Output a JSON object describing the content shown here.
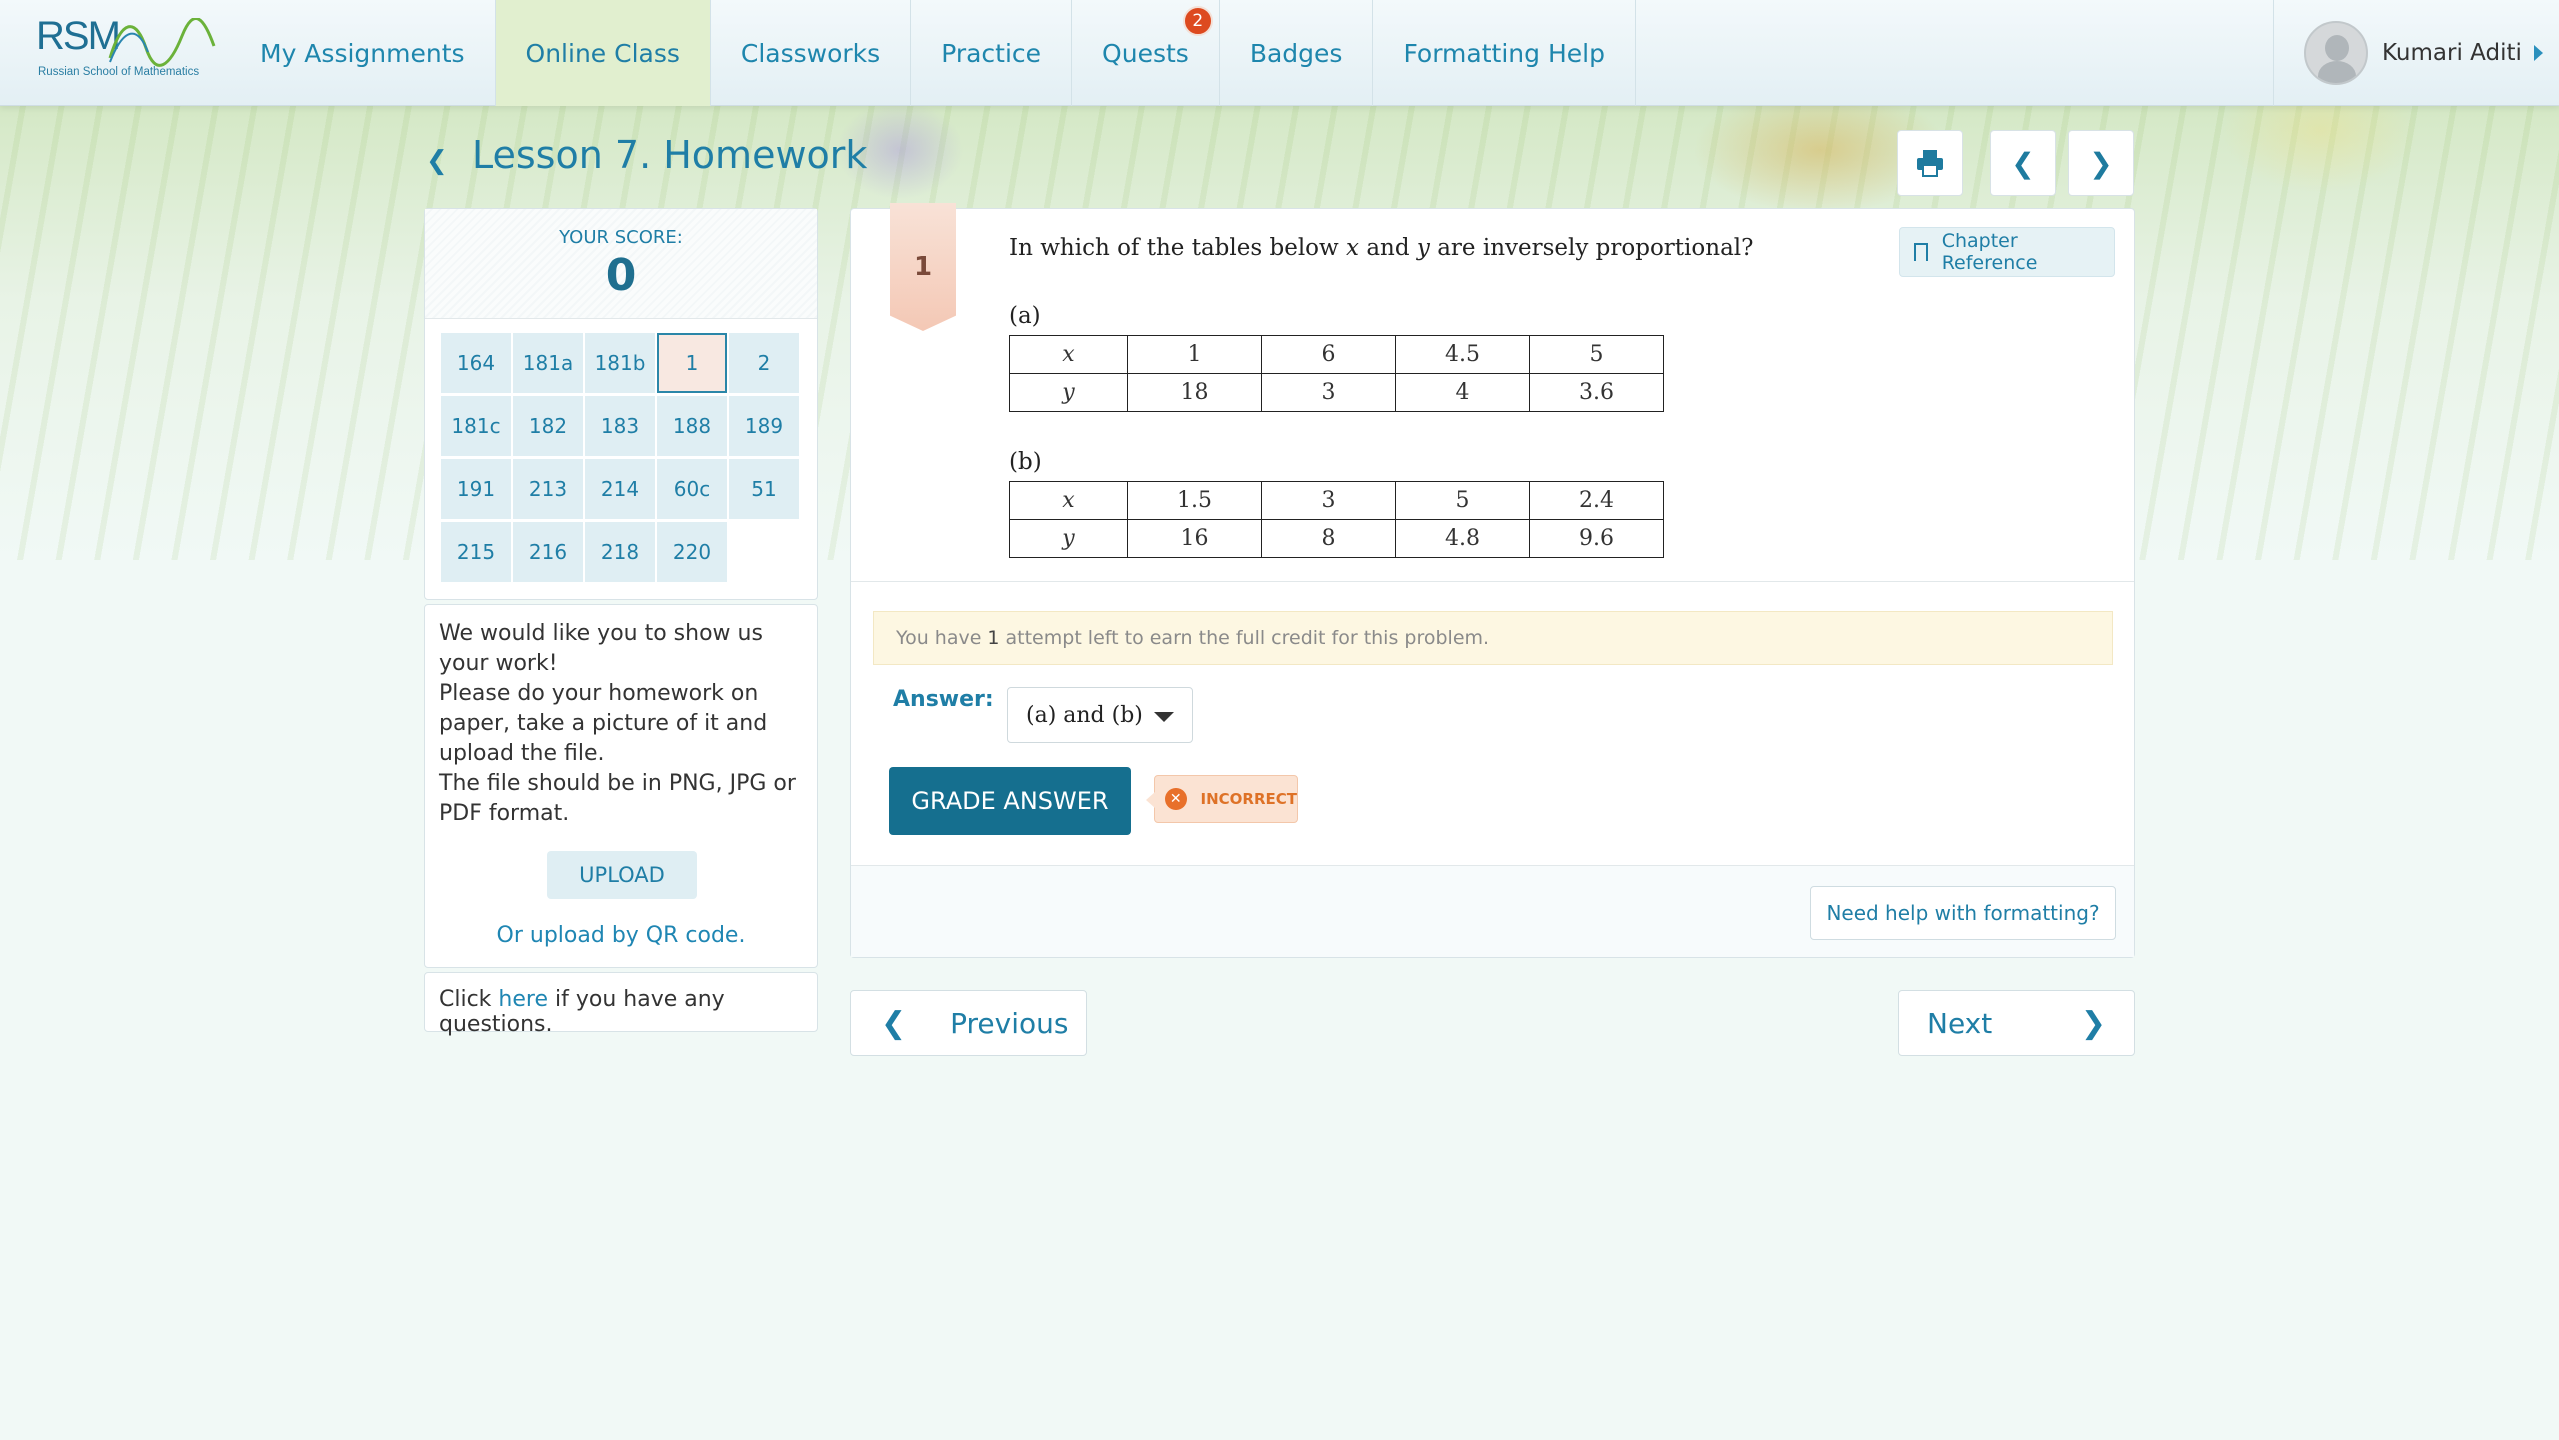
{
  "header": {
    "logo_main": "RSM",
    "logo_sub": "Russian School of Mathematics",
    "nav": [
      {
        "label": "My Assignments"
      },
      {
        "label": "Online Class"
      },
      {
        "label": "Classworks"
      },
      {
        "label": "Practice"
      },
      {
        "label": "Quests",
        "badge": "2"
      },
      {
        "label": "Badges"
      },
      {
        "label": "Formatting Help"
      }
    ],
    "active_nav": "Online Class",
    "user_name": "Kumari Aditi"
  },
  "lesson": {
    "title": "Lesson 7. Homework"
  },
  "score": {
    "label": "YOUR SCORE:",
    "value": "0"
  },
  "problems": [
    "164",
    "181a",
    "181b",
    "1",
    "2",
    "181c",
    "182",
    "183",
    "188",
    "189",
    "191",
    "213",
    "214",
    "60c",
    "51",
    "215",
    "216",
    "218",
    "220"
  ],
  "current_problem": "1",
  "upload": {
    "line1": "We would like you to show us your work!",
    "line2": "Please do your homework on paper, take a picture of it and upload the file.",
    "line3": "The file should be in PNG, JPG or PDF format.",
    "button": "UPLOAD",
    "qr_link": "Or upload by QR code."
  },
  "questions": {
    "prefix": "Click",
    "link": "here",
    "suffix": "if you have any questions."
  },
  "problem": {
    "number": "1",
    "chapter_ref": "Chapter Reference",
    "question_pre": "In which of the tables below",
    "var_x": "x",
    "question_and": "and",
    "var_y": "y",
    "question_post": "are inversely proportional?",
    "table_a": {
      "label": "(a)",
      "x": [
        "1",
        "6",
        "4.5",
        "5"
      ],
      "y": [
        "18",
        "3",
        "4",
        "3.6"
      ]
    },
    "table_b": {
      "label": "(b)",
      "x": [
        "1.5",
        "3",
        "5",
        "2.4"
      ],
      "y": [
        "16",
        "8",
        "4.8",
        "9.6"
      ]
    },
    "notice_pre": "You have",
    "notice_count": "1",
    "notice_post": "attempt left to earn the full credit for this problem.",
    "answer_label": "Answer:",
    "answer_value": "(a) and (b)",
    "grade_button": "GRADE ANSWER",
    "result": "INCORRECT",
    "help_button": "Need help with formatting?"
  },
  "pager": {
    "previous": "Previous",
    "next": "Next"
  },
  "colors": {
    "accent": "#1f7ea6",
    "grade_button": "#156f8f",
    "incorrect": "#de7227",
    "badge": "#dd4a1f"
  }
}
